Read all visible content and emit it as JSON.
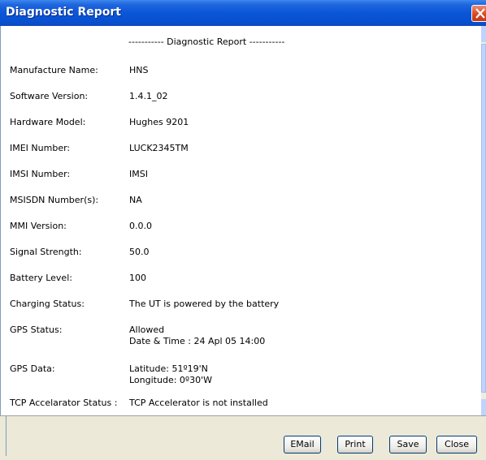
{
  "window": {
    "title": "Diagnostic Report"
  },
  "report": {
    "header": "----------- Diagnostic Report -----------",
    "rows": [
      {
        "label": "Manufacture Name:",
        "values": [
          "HNS"
        ]
      },
      {
        "label": "Software Version:",
        "values": [
          "1.4.1_02"
        ]
      },
      {
        "label": "Hardware Model:",
        "values": [
          "Hughes 9201"
        ]
      },
      {
        "label": "IMEI Number:",
        "values": [
          "LUCK2345TM"
        ]
      },
      {
        "label": "IMSI Number:",
        "values": [
          "IMSI"
        ]
      },
      {
        "label": "MSISDN Number(s):",
        "values": [
          "NA"
        ]
      },
      {
        "label": "MMI Version:",
        "values": [
          "0.0.0"
        ]
      },
      {
        "label": "Signal Strength:",
        "values": [
          "50.0"
        ]
      },
      {
        "label": "Battery Level:",
        "values": [
          "100"
        ]
      },
      {
        "label": "Charging Status:",
        "values": [
          "The UT is powered by the battery"
        ]
      },
      {
        "label": "GPS Status:",
        "values": [
          "Allowed",
          "Date & Time : 24 Apl 05 14:00"
        ]
      },
      {
        "label": "GPS Data:",
        "values": [
          "Latitude: 51º19'N",
          "Longitude: 0º30'W"
        ]
      },
      {
        "label": "TCP Accelarator Status :",
        "values": [
          "TCP Accelerator is not installed"
        ]
      }
    ]
  },
  "buttons": {
    "email": "EMail",
    "print": "Print",
    "save": "Save",
    "close": "Close"
  }
}
